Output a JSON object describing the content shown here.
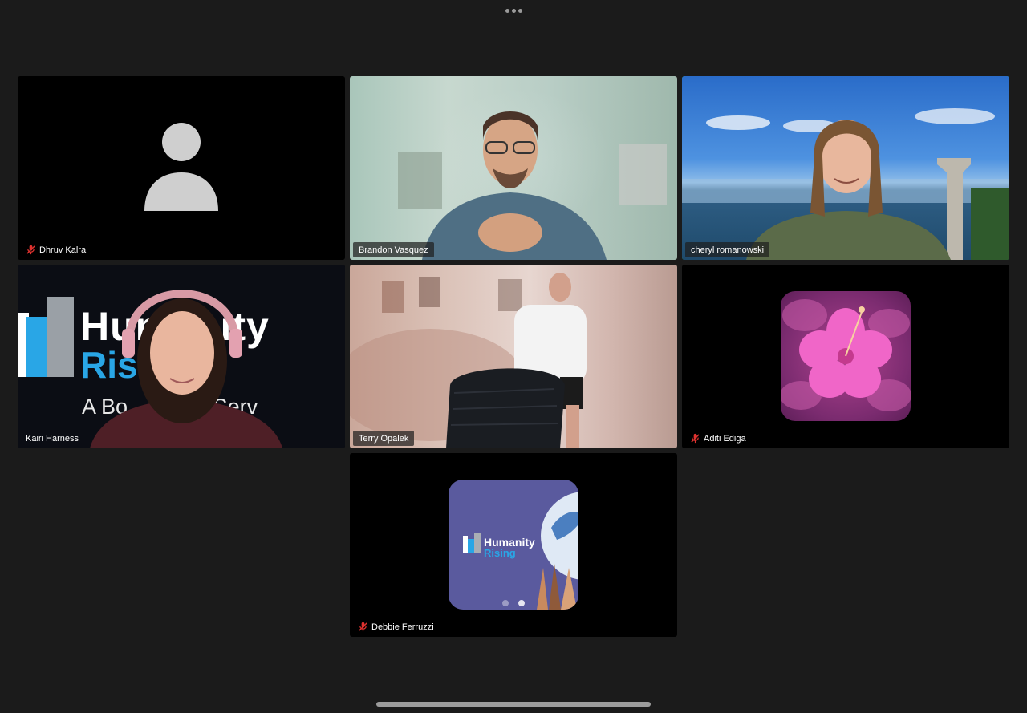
{
  "top_bar": {
    "more_icon": "more-options-icon"
  },
  "participants": [
    {
      "name": "Dhruv Kalra",
      "muted": true,
      "video": false
    },
    {
      "name": "Brandon Vasquez",
      "muted": false,
      "video": true
    },
    {
      "name": "cheryl romanowski",
      "muted": false,
      "video": true,
      "active_speaker": true
    },
    {
      "name": "Kairi Harness",
      "muted": false,
      "video": true
    },
    {
      "name": "Terry Opalek",
      "muted": false,
      "video": true
    },
    {
      "name": "Aditi Ediga",
      "muted": true,
      "video": false
    },
    {
      "name": "Debbie Ferruzzi",
      "muted": true,
      "video": false
    }
  ],
  "kairi_background": {
    "logo_line1": "Humanity",
    "logo_line2": "Rising",
    "tagline": "A Bo... rough Serv"
  },
  "debbie_avatar": {
    "line1": "Humanity",
    "line2": "Rising"
  },
  "colors": {
    "background": "#1b1b1b",
    "tile": "#000000",
    "active_speaker_border": "#2fd157",
    "mute_red": "#e0322f",
    "brand_blue": "#29a6e6"
  }
}
